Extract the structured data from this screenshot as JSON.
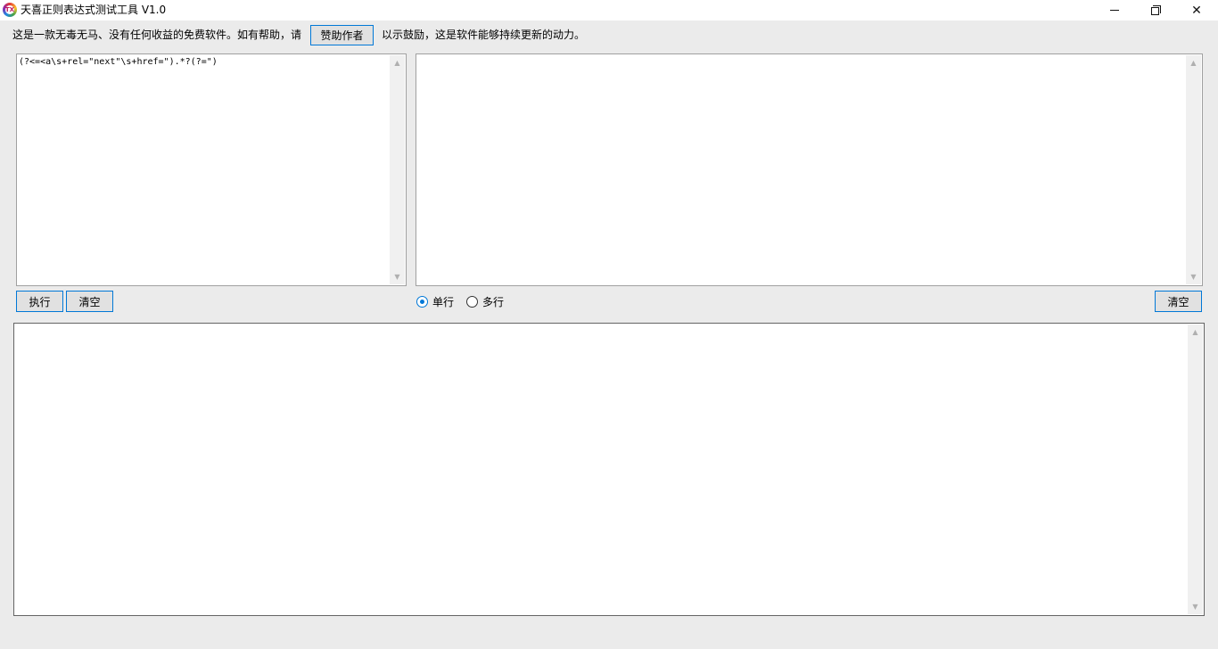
{
  "window": {
    "title": "天喜正则表达式测试工具 V1.0",
    "icon_text": "TX",
    "minimize_symbol": "",
    "maximize_symbol": "",
    "close_symbol": "✕"
  },
  "notice": {
    "before": "这是一款无毒无马、没有任何收益的免费软件。如有帮助，请",
    "button_label": "赞助作者",
    "after": "以示鼓励，这是软件能够持续更新的动力。"
  },
  "regex_box": {
    "value": "(?<=<a\\s+rel=\"next\"\\s+href=\").*?(?=\")"
  },
  "source_box": {
    "value": ""
  },
  "result_box": {
    "value": ""
  },
  "buttons": {
    "execute": "执行",
    "clear_left": "清空",
    "clear_right": "清空"
  },
  "mode": {
    "single_line": "单行",
    "multi_line": "多行",
    "selected": "单行"
  },
  "scroll_arrows": {
    "up": "▲",
    "down": "▼"
  },
  "colors": {
    "accent": "#0078d7",
    "window_bg": "#ebebeb",
    "button_bg": "#e1e1e1"
  }
}
